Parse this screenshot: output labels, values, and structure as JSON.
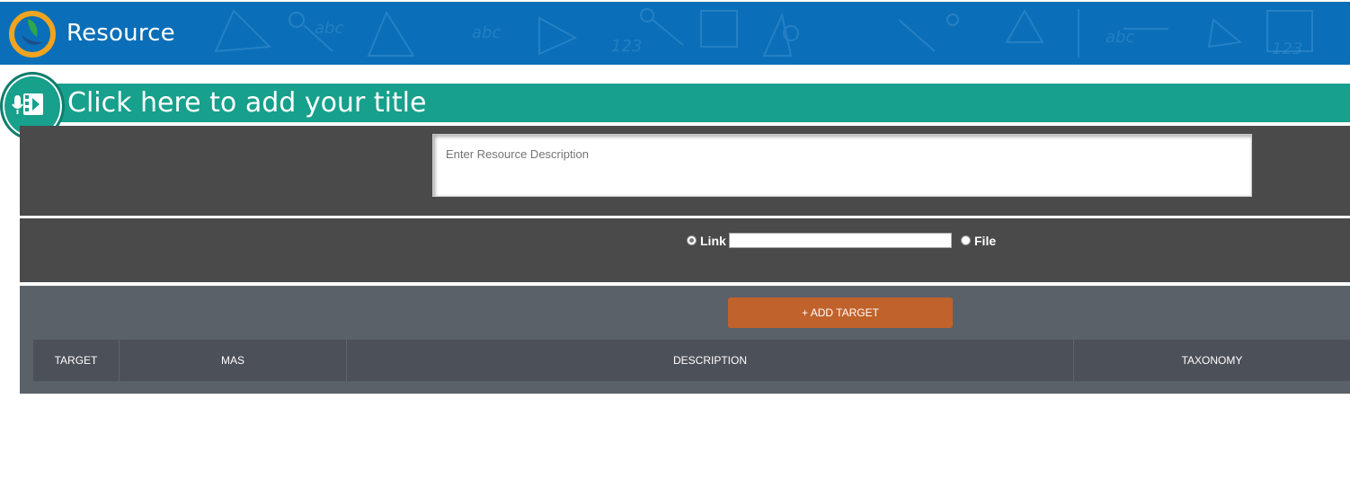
{
  "header": {
    "title": "Resource",
    "colors": {
      "background": "#0a6fb8",
      "logo_ring": "#f0a420",
      "logo_inner": "#2ea64a"
    }
  },
  "title_banner": {
    "text": "Click here to add your title",
    "icon": "media-resource-icon",
    "color": "#17a08c"
  },
  "description": {
    "placeholder": "Enter Resource Description",
    "value": ""
  },
  "source": {
    "options": [
      {
        "label": "Link",
        "checked": true
      },
      {
        "label": "File",
        "checked": false
      }
    ],
    "link_value": ""
  },
  "targets": {
    "add_button_label": "+ ADD TARGET",
    "button_color": "#c0622b",
    "columns": [
      "TARGET",
      "MAS",
      "DESCRIPTION",
      "TAXONOMY"
    ],
    "rows": []
  }
}
